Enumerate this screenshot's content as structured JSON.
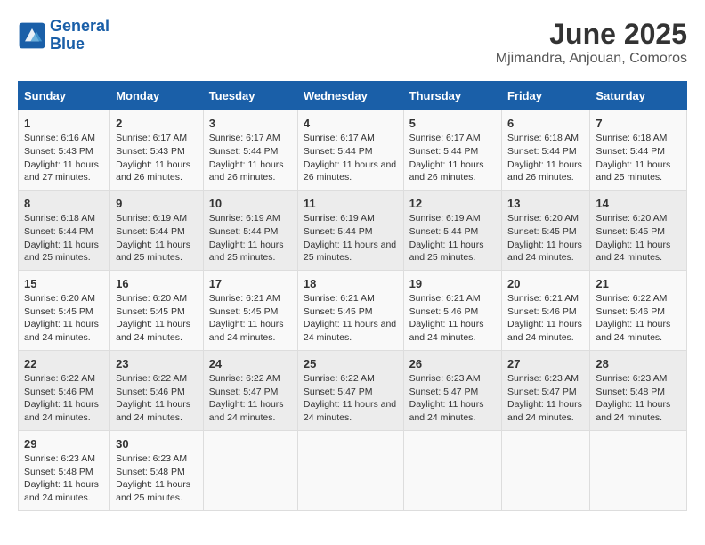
{
  "logo": {
    "line1": "General",
    "line2": "Blue"
  },
  "title": "June 2025",
  "subtitle": "Mjimandra, Anjouan, Comoros",
  "days_of_week": [
    "Sunday",
    "Monday",
    "Tuesday",
    "Wednesday",
    "Thursday",
    "Friday",
    "Saturday"
  ],
  "weeks": [
    [
      {
        "day": "1",
        "sunrise": "6:16 AM",
        "sunset": "5:43 PM",
        "daylight": "11 hours and 27 minutes."
      },
      {
        "day": "2",
        "sunrise": "6:17 AM",
        "sunset": "5:43 PM",
        "daylight": "11 hours and 26 minutes."
      },
      {
        "day": "3",
        "sunrise": "6:17 AM",
        "sunset": "5:44 PM",
        "daylight": "11 hours and 26 minutes."
      },
      {
        "day": "4",
        "sunrise": "6:17 AM",
        "sunset": "5:44 PM",
        "daylight": "11 hours and 26 minutes."
      },
      {
        "day": "5",
        "sunrise": "6:17 AM",
        "sunset": "5:44 PM",
        "daylight": "11 hours and 26 minutes."
      },
      {
        "day": "6",
        "sunrise": "6:18 AM",
        "sunset": "5:44 PM",
        "daylight": "11 hours and 26 minutes."
      },
      {
        "day": "7",
        "sunrise": "6:18 AM",
        "sunset": "5:44 PM",
        "daylight": "11 hours and 25 minutes."
      }
    ],
    [
      {
        "day": "8",
        "sunrise": "6:18 AM",
        "sunset": "5:44 PM",
        "daylight": "11 hours and 25 minutes."
      },
      {
        "day": "9",
        "sunrise": "6:19 AM",
        "sunset": "5:44 PM",
        "daylight": "11 hours and 25 minutes."
      },
      {
        "day": "10",
        "sunrise": "6:19 AM",
        "sunset": "5:44 PM",
        "daylight": "11 hours and 25 minutes."
      },
      {
        "day": "11",
        "sunrise": "6:19 AM",
        "sunset": "5:44 PM",
        "daylight": "11 hours and 25 minutes."
      },
      {
        "day": "12",
        "sunrise": "6:19 AM",
        "sunset": "5:44 PM",
        "daylight": "11 hours and 25 minutes."
      },
      {
        "day": "13",
        "sunrise": "6:20 AM",
        "sunset": "5:45 PM",
        "daylight": "11 hours and 24 minutes."
      },
      {
        "day": "14",
        "sunrise": "6:20 AM",
        "sunset": "5:45 PM",
        "daylight": "11 hours and 24 minutes."
      }
    ],
    [
      {
        "day": "15",
        "sunrise": "6:20 AM",
        "sunset": "5:45 PM",
        "daylight": "11 hours and 24 minutes."
      },
      {
        "day": "16",
        "sunrise": "6:20 AM",
        "sunset": "5:45 PM",
        "daylight": "11 hours and 24 minutes."
      },
      {
        "day": "17",
        "sunrise": "6:21 AM",
        "sunset": "5:45 PM",
        "daylight": "11 hours and 24 minutes."
      },
      {
        "day": "18",
        "sunrise": "6:21 AM",
        "sunset": "5:45 PM",
        "daylight": "11 hours and 24 minutes."
      },
      {
        "day": "19",
        "sunrise": "6:21 AM",
        "sunset": "5:46 PM",
        "daylight": "11 hours and 24 minutes."
      },
      {
        "day": "20",
        "sunrise": "6:21 AM",
        "sunset": "5:46 PM",
        "daylight": "11 hours and 24 minutes."
      },
      {
        "day": "21",
        "sunrise": "6:22 AM",
        "sunset": "5:46 PM",
        "daylight": "11 hours and 24 minutes."
      }
    ],
    [
      {
        "day": "22",
        "sunrise": "6:22 AM",
        "sunset": "5:46 PM",
        "daylight": "11 hours and 24 minutes."
      },
      {
        "day": "23",
        "sunrise": "6:22 AM",
        "sunset": "5:46 PM",
        "daylight": "11 hours and 24 minutes."
      },
      {
        "day": "24",
        "sunrise": "6:22 AM",
        "sunset": "5:47 PM",
        "daylight": "11 hours and 24 minutes."
      },
      {
        "day": "25",
        "sunrise": "6:22 AM",
        "sunset": "5:47 PM",
        "daylight": "11 hours and 24 minutes."
      },
      {
        "day": "26",
        "sunrise": "6:23 AM",
        "sunset": "5:47 PM",
        "daylight": "11 hours and 24 minutes."
      },
      {
        "day": "27",
        "sunrise": "6:23 AM",
        "sunset": "5:47 PM",
        "daylight": "11 hours and 24 minutes."
      },
      {
        "day": "28",
        "sunrise": "6:23 AM",
        "sunset": "5:48 PM",
        "daylight": "11 hours and 24 minutes."
      }
    ],
    [
      {
        "day": "29",
        "sunrise": "6:23 AM",
        "sunset": "5:48 PM",
        "daylight": "11 hours and 24 minutes."
      },
      {
        "day": "30",
        "sunrise": "6:23 AM",
        "sunset": "5:48 PM",
        "daylight": "11 hours and 25 minutes."
      },
      null,
      null,
      null,
      null,
      null
    ]
  ],
  "labels": {
    "sunrise": "Sunrise:",
    "sunset": "Sunset:",
    "daylight": "Daylight:"
  }
}
